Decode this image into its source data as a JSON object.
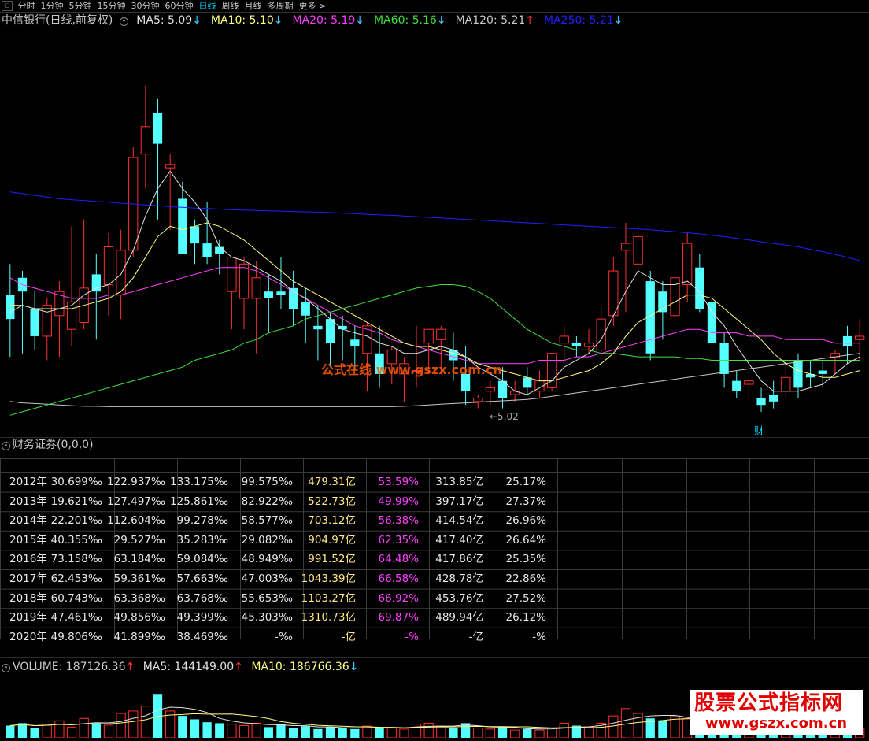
{
  "toolbar": {
    "tabs": [
      {
        "label": "分时",
        "active": false
      },
      {
        "label": "1分钟",
        "active": false
      },
      {
        "label": "5分钟",
        "active": false
      },
      {
        "label": "15分钟",
        "active": false
      },
      {
        "label": "30分钟",
        "active": false
      },
      {
        "label": "60分钟",
        "active": false
      },
      {
        "label": "日线",
        "active": true
      },
      {
        "label": "周线",
        "active": false
      },
      {
        "label": "月线",
        "active": false
      },
      {
        "label": "多周期",
        "active": false
      },
      {
        "label": "更多 >",
        "active": false
      }
    ]
  },
  "kline": {
    "title": "中信银行(日线,前复权)",
    "ma": [
      {
        "label": "MA5: 5.09",
        "arrow": "↓",
        "color": "#e0e0e0"
      },
      {
        "label": "MA10: 5.10",
        "arrow": "↓",
        "color": "#ffff80"
      },
      {
        "label": "MA20: 5.19",
        "arrow": "↓",
        "color": "#ff40ff"
      },
      {
        "label": "MA60: 5.16",
        "arrow": "↓",
        "color": "#40e040"
      },
      {
        "label": "MA120: 5.21",
        "arrow": "↑",
        "color": "#c8c8c8"
      },
      {
        "label": "MA250: 5.21",
        "arrow": "↓",
        "color": "#2020ff"
      }
    ],
    "low_label": "←5.02",
    "badge": "财",
    "watermark": "公式在线 www.gszx.com.cn",
    "candles": [
      [
        5.35,
        5.44,
        5.17,
        5.28
      ],
      [
        5.4,
        5.42,
        5.18,
        5.36
      ],
      [
        5.31,
        5.36,
        5.19,
        5.23
      ],
      [
        5.23,
        5.34,
        5.16,
        5.32
      ],
      [
        5.29,
        5.39,
        5.17,
        5.36
      ],
      [
        5.25,
        5.55,
        5.2,
        5.33
      ],
      [
        5.27,
        5.57,
        5.25,
        5.37
      ],
      [
        5.41,
        5.47,
        5.22,
        5.36
      ],
      [
        5.38,
        5.53,
        5.29,
        5.49
      ],
      [
        5.35,
        5.54,
        5.28,
        5.48
      ],
      [
        5.48,
        5.78,
        5.46,
        5.75
      ],
      [
        5.76,
        5.96,
        5.66,
        5.84
      ],
      [
        5.88,
        5.92,
        5.57,
        5.79
      ],
      [
        5.72,
        5.76,
        5.54,
        5.73
      ],
      [
        5.63,
        5.68,
        5.48,
        5.47
      ],
      [
        5.55,
        5.57,
        5.44,
        5.5
      ],
      [
        5.5,
        5.62,
        5.44,
        5.46
      ],
      [
        5.49,
        5.51,
        5.41,
        5.47
      ],
      [
        5.36,
        5.46,
        5.25,
        5.46
      ],
      [
        5.34,
        5.46,
        5.25,
        5.44
      ],
      [
        5.34,
        5.45,
        5.18,
        5.4
      ],
      [
        5.36,
        5.41,
        5.24,
        5.34
      ],
      [
        5.36,
        5.46,
        5.31,
        5.35
      ],
      [
        5.37,
        5.42,
        5.26,
        5.31
      ],
      [
        5.33,
        5.37,
        5.21,
        5.29
      ],
      [
        5.26,
        5.32,
        5.16,
        5.25
      ],
      [
        5.28,
        5.3,
        5.14,
        5.21
      ],
      [
        5.26,
        5.29,
        5.16,
        5.25
      ],
      [
        5.22,
        5.26,
        5.13,
        5.2
      ],
      [
        5.18,
        5.27,
        5.07,
        5.26
      ],
      [
        5.18,
        5.26,
        5.08,
        5.12
      ],
      [
        5.15,
        5.2,
        5.09,
        5.19
      ],
      [
        5.12,
        5.17,
        5.04,
        5.15
      ],
      [
        5.13,
        5.26,
        5.08,
        5.13
      ],
      [
        5.21,
        5.24,
        5.12,
        5.25
      ],
      [
        5.22,
        5.26,
        5.12,
        5.25
      ],
      [
        5.19,
        5.24,
        5.1,
        5.16
      ],
      [
        5.12,
        5.2,
        5.03,
        5.07
      ],
      [
        5.04,
        5.06,
        5.02,
        5.05
      ],
      [
        5.07,
        5.1,
        5.03,
        5.08
      ],
      [
        5.1,
        5.14,
        5.02,
        5.05
      ],
      [
        5.06,
        5.1,
        5.04,
        5.07
      ],
      [
        5.11,
        5.14,
        5.06,
        5.08
      ],
      [
        5.07,
        5.13,
        5.05,
        5.1
      ],
      [
        5.08,
        5.17,
        5.07,
        5.18
      ],
      [
        5.21,
        5.26,
        5.16,
        5.23
      ],
      [
        5.21,
        5.23,
        5.17,
        5.2
      ],
      [
        5.2,
        5.25,
        5.18,
        5.21
      ],
      [
        5.19,
        5.32,
        5.17,
        5.28
      ],
      [
        5.29,
        5.46,
        5.26,
        5.42
      ],
      [
        5.48,
        5.56,
        5.3,
        5.5
      ],
      [
        5.44,
        5.56,
        5.4,
        5.52
      ],
      [
        5.39,
        5.42,
        5.16,
        5.18
      ],
      [
        5.36,
        5.39,
        5.22,
        5.3
      ],
      [
        5.29,
        5.52,
        5.26,
        5.4
      ],
      [
        5.38,
        5.53,
        5.33,
        5.5
      ],
      [
        5.43,
        5.47,
        5.3,
        5.31
      ],
      [
        5.33,
        5.36,
        5.14,
        5.21
      ],
      [
        5.21,
        5.24,
        5.08,
        5.12
      ],
      [
        5.1,
        5.13,
        5.05,
        5.07
      ],
      [
        5.09,
        5.17,
        5.04,
        5.1
      ],
      [
        5.05,
        5.08,
        5.01,
        5.03
      ],
      [
        5.06,
        5.1,
        5.02,
        5.04
      ],
      [
        5.07,
        5.15,
        5.05,
        5.11
      ],
      [
        5.16,
        5.18,
        5.05,
        5.08
      ],
      [
        5.12,
        5.16,
        5.08,
        5.11
      ],
      [
        5.13,
        5.16,
        5.08,
        5.12
      ],
      [
        5.17,
        5.19,
        5.12,
        5.18
      ],
      [
        5.23,
        5.26,
        5.15,
        5.2
      ],
      [
        5.22,
        5.28,
        5.16,
        5.23
      ]
    ],
    "ma5": [
      5.3,
      5.32,
      5.31,
      5.3,
      5.31,
      5.32,
      5.35,
      5.37,
      5.38,
      5.41,
      5.48,
      5.58,
      5.66,
      5.71,
      5.66,
      5.62,
      5.57,
      5.49,
      5.46,
      5.45,
      5.43,
      5.41,
      5.39,
      5.36,
      5.34,
      5.31,
      5.28,
      5.25,
      5.24,
      5.23,
      5.21,
      5.2,
      5.18,
      5.18,
      5.19,
      5.2,
      5.19,
      5.17,
      5.14,
      5.12,
      5.1,
      5.07,
      5.06,
      5.08,
      5.1,
      5.14,
      5.16,
      5.18,
      5.22,
      5.29,
      5.36,
      5.42,
      5.4,
      5.38,
      5.38,
      5.39,
      5.36,
      5.3,
      5.26,
      5.2,
      5.15,
      5.1,
      5.07,
      5.07,
      5.07,
      5.08,
      5.09,
      5.12,
      5.15,
      5.17
    ],
    "ma10": [
      5.32,
      5.32,
      5.31,
      5.31,
      5.31,
      5.31,
      5.32,
      5.33,
      5.34,
      5.36,
      5.4,
      5.46,
      5.52,
      5.55,
      5.54,
      5.55,
      5.56,
      5.55,
      5.53,
      5.51,
      5.48,
      5.45,
      5.42,
      5.39,
      5.37,
      5.35,
      5.33,
      5.31,
      5.29,
      5.27,
      5.25,
      5.23,
      5.21,
      5.2,
      5.2,
      5.19,
      5.18,
      5.17,
      5.15,
      5.14,
      5.13,
      5.12,
      5.11,
      5.1,
      5.1,
      5.11,
      5.12,
      5.13,
      5.15,
      5.18,
      5.23,
      5.27,
      5.29,
      5.31,
      5.33,
      5.35,
      5.35,
      5.34,
      5.31,
      5.28,
      5.25,
      5.22,
      5.18,
      5.15,
      5.13,
      5.12,
      5.11,
      5.11,
      5.12,
      5.13
    ],
    "ma20": [
      5.4,
      5.38,
      5.37,
      5.36,
      5.35,
      5.34,
      5.34,
      5.34,
      5.35,
      5.35,
      5.36,
      5.37,
      5.38,
      5.39,
      5.4,
      5.41,
      5.42,
      5.43,
      5.43,
      5.43,
      5.42,
      5.4,
      5.38,
      5.36,
      5.34,
      5.32,
      5.3,
      5.28,
      5.26,
      5.25,
      5.24,
      5.22,
      5.21,
      5.2,
      5.19,
      5.18,
      5.17,
      5.16,
      5.15,
      5.15,
      5.15,
      5.15,
      5.15,
      5.16,
      5.16,
      5.16,
      5.17,
      5.17,
      5.18,
      5.19,
      5.2,
      5.21,
      5.22,
      5.23,
      5.24,
      5.25,
      5.25,
      5.24,
      5.24,
      5.24,
      5.23,
      5.23,
      5.23,
      5.22,
      5.22,
      5.22,
      5.22,
      5.21,
      5.21,
      5.21
    ],
    "ma60": [
      5.0,
      5.01,
      5.02,
      5.03,
      5.04,
      5.05,
      5.06,
      5.07,
      5.08,
      5.09,
      5.1,
      5.11,
      5.12,
      5.13,
      5.14,
      5.16,
      5.17,
      5.18,
      5.19,
      5.21,
      5.22,
      5.24,
      5.25,
      5.26,
      5.28,
      5.29,
      5.3,
      5.31,
      5.32,
      5.33,
      5.34,
      5.35,
      5.36,
      5.37,
      5.375,
      5.38,
      5.38,
      5.375,
      5.36,
      5.34,
      5.31,
      5.28,
      5.25,
      5.23,
      5.21,
      5.2,
      5.19,
      5.19,
      5.18,
      5.18,
      5.175,
      5.17,
      5.17,
      5.17,
      5.17,
      5.165,
      5.165,
      5.16,
      5.16,
      5.16,
      5.16,
      5.16,
      5.16,
      5.16,
      5.16,
      5.16,
      5.16,
      5.16,
      5.16,
      5.16
    ],
    "ma120": [
      5.04,
      5.036,
      5.034,
      5.032,
      5.03,
      5.028,
      5.026,
      5.026,
      5.025,
      5.025,
      5.025,
      5.025,
      5.025,
      5.025,
      5.025,
      5.025,
      5.025,
      5.025,
      5.025,
      5.025,
      5.025,
      5.025,
      5.025,
      5.025,
      5.025,
      5.025,
      5.025,
      5.025,
      5.025,
      5.025,
      5.025,
      5.025,
      5.026,
      5.028,
      5.03,
      5.032,
      5.034,
      5.036,
      5.038,
      5.04,
      5.042,
      5.044,
      5.046,
      5.05,
      5.055,
      5.06,
      5.065,
      5.07,
      5.075,
      5.08,
      5.085,
      5.09,
      5.095,
      5.1,
      5.105,
      5.11,
      5.115,
      5.12,
      5.125,
      5.13,
      5.135,
      5.14,
      5.145,
      5.15,
      5.155,
      5.16,
      5.165,
      5.17,
      5.175,
      5.18
    ],
    "ma250": [
      5.65,
      5.645,
      5.64,
      5.635,
      5.63,
      5.627,
      5.625,
      5.622,
      5.62,
      5.617,
      5.615,
      5.612,
      5.61,
      5.607,
      5.605,
      5.603,
      5.602,
      5.6,
      5.598,
      5.597,
      5.596,
      5.595,
      5.594,
      5.593,
      5.592,
      5.591,
      5.59,
      5.588,
      5.587,
      5.585,
      5.583,
      5.582,
      5.58,
      5.578,
      5.576,
      5.574,
      5.572,
      5.57,
      5.568,
      5.566,
      5.564,
      5.562,
      5.56,
      5.558,
      5.556,
      5.554,
      5.552,
      5.55,
      5.548,
      5.546,
      5.544,
      5.542,
      5.54,
      5.537,
      5.534,
      5.531,
      5.528,
      5.524,
      5.52,
      5.515,
      5.51,
      5.505,
      5.5,
      5.495,
      5.49,
      5.483,
      5.476,
      5.468,
      5.46,
      5.45
    ]
  },
  "finance": {
    "title": "财务证券(0,0,0)",
    "rows": [
      [
        "2012年",
        "30.699‰",
        "122.937‰",
        "133.175‰",
        "99.575‰",
        "479.31亿",
        "53.59%",
        "313.85亿",
        "25.17%"
      ],
      [
        "2013年",
        "19.621‰",
        "127.497‰",
        "125.861‰",
        "82.922‰",
        "522.73亿",
        "49.99%",
        "397.17亿",
        "27.37%"
      ],
      [
        "2014年",
        "22.201‰",
        "112.604‰",
        "99.278‰",
        "58.577‰",
        "703.12亿",
        "56.38%",
        "414.54亿",
        "26.96%"
      ],
      [
        "2015年",
        "40.355‰",
        "29.527‰",
        "35.283‰",
        "29.082‰",
        "904.97亿",
        "62.35%",
        "417.40亿",
        "26.64%"
      ],
      [
        "2016年",
        "73.158‰",
        "63.184‰",
        "59.084‰",
        "48.949‰",
        "991.52亿",
        "64.48%",
        "417.86亿",
        "25.35%"
      ],
      [
        "2017年",
        "62.453‰",
        "59.361‰",
        "57.663‰",
        "47.003‰",
        "1043.39亿",
        "66.58%",
        "428.78亿",
        "22.86%"
      ],
      [
        "2018年",
        "60.743‰",
        "63.368‰",
        "63.768‰",
        "55.653‰",
        "1103.27亿",
        "66.92%",
        "453.76亿",
        "27.52%"
      ],
      [
        "2019年",
        "47.461‰",
        "49.856‰",
        "49.399‰",
        "45.303‰",
        "1310.73亿",
        "69.87%",
        "489.94亿",
        "26.12%"
      ],
      [
        "2020年",
        "49.806‰",
        "41.899‰",
        "38.469‰",
        "-‰",
        "-亿",
        "-%",
        "-亿",
        "-%"
      ]
    ]
  },
  "volume": {
    "label": "VOLUME: 187126.36",
    "label_arrow": "↑",
    "ma5_label": "MA5: 144149.00",
    "ma5_arrow": "↑",
    "ma10_label": "MA10: 186766.36",
    "ma10_arrow": "↓",
    "bars": [
      0.25,
      0.3,
      0.2,
      0.28,
      0.35,
      0.22,
      0.4,
      0.3,
      0.26,
      0.5,
      0.55,
      0.65,
      0.9,
      0.55,
      0.45,
      0.38,
      0.32,
      0.3,
      0.28,
      0.25,
      0.3,
      0.22,
      0.28,
      0.2,
      0.24,
      0.18,
      0.22,
      0.2,
      0.18,
      0.24,
      0.22,
      0.2,
      0.18,
      0.28,
      0.3,
      0.24,
      0.2,
      0.3,
      0.2,
      0.18,
      0.22,
      0.16,
      0.18,
      0.16,
      0.2,
      0.3,
      0.25,
      0.22,
      0.3,
      0.45,
      0.6,
      0.5,
      0.4,
      0.35,
      0.45,
      0.4,
      0.35,
      0.3,
      0.28,
      0.24,
      0.22,
      0.2,
      0.2,
      0.18,
      0.2,
      0.16,
      0.18,
      0.2,
      0.22,
      0.2
    ],
    "max": 200000
  },
  "brand": {
    "title": "股票公式指标网",
    "url": "www.gszx.com.cn"
  },
  "colors": {
    "up": "#ff3030",
    "down": "#54ffff",
    "grid": "#3a3a3a"
  }
}
